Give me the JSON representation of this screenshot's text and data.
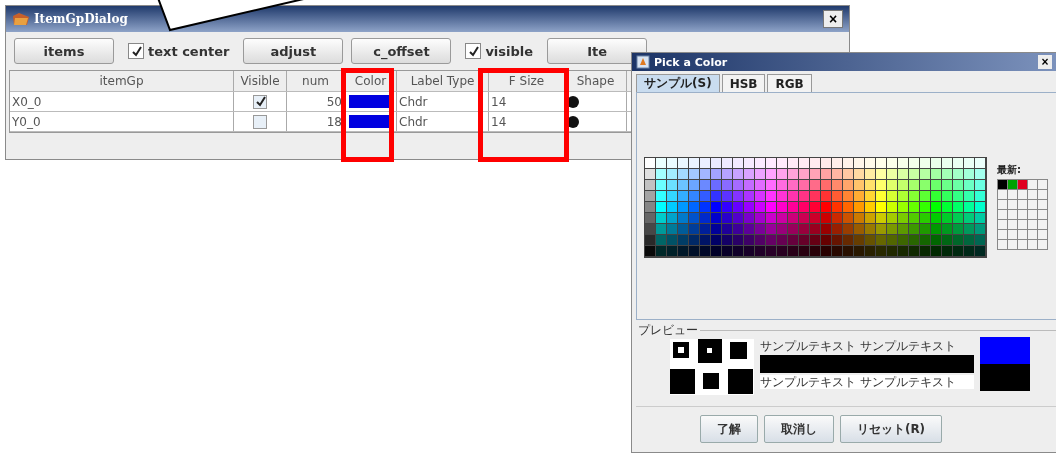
{
  "item_dialog": {
    "title": "ItemGpDialog",
    "close": "×",
    "toolbar": [
      {
        "kind": "button",
        "label": "items"
      },
      {
        "kind": "checkbox",
        "label": "text center",
        "checked": true
      },
      {
        "kind": "button",
        "label": "adjust"
      },
      {
        "kind": "button",
        "label": "c_offset"
      },
      {
        "kind": "checkbox",
        "label": "visible",
        "checked": true
      },
      {
        "kind": "button",
        "label": "Ite"
      }
    ],
    "table": {
      "columns": [
        "itemGp",
        "Visible",
        "num",
        "Color",
        "Label Type",
        "F Size",
        "Shape"
      ],
      "rows": [
        {
          "itemGp": "X0_0",
          "visible": true,
          "num": "50",
          "color": "#0000e0",
          "label_type": "Chdr",
          "f_size": "14"
        },
        {
          "itemGp": "Y0_0",
          "visible": false,
          "num": "18",
          "color": "#0000e0",
          "label_type": "Chdr",
          "f_size": "14"
        }
      ]
    }
  },
  "color_picker": {
    "title": "Pick a Color",
    "close": "×",
    "tabs": [
      {
        "label": "サンプル(S)",
        "selected": true
      },
      {
        "label": "HSB",
        "selected": false
      },
      {
        "label": "RGB",
        "selected": false
      }
    ],
    "recent_label": "最新:",
    "recent": [
      {
        "color": "#000000"
      },
      {
        "color": "#00a000"
      },
      {
        "color": "#e00020"
      }
    ],
    "preview_label": "プレビュー",
    "preview_text_top": "サンプルテキスト サンプルテキスト",
    "preview_text_bottom": "サンプルテキスト サンプルテキスト",
    "buttons": [
      "了解",
      "取消し",
      "リセット(R)"
    ]
  }
}
